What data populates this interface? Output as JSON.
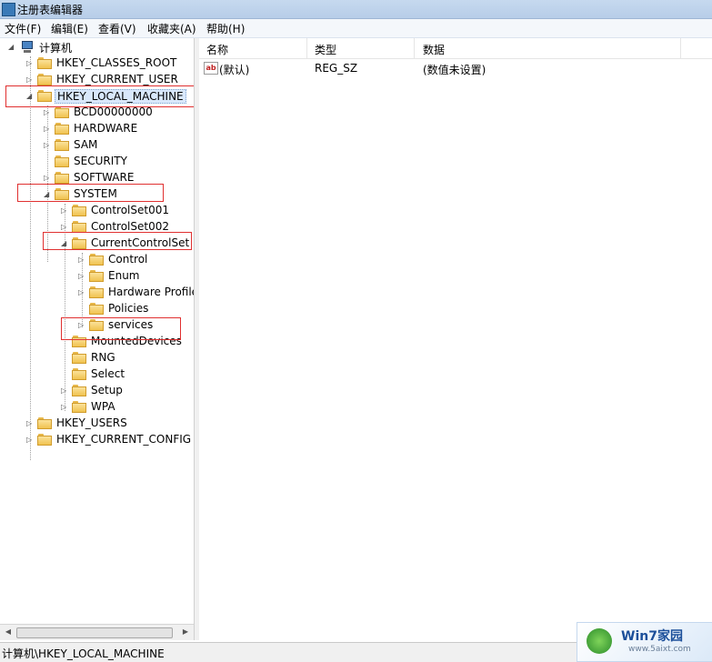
{
  "window": {
    "title": "注册表编辑器"
  },
  "menu": [
    "文件(F)",
    "编辑(E)",
    "查看(V)",
    "收藏夹(A)",
    "帮助(H)"
  ],
  "tree": {
    "root": "计算机",
    "hkcr": "HKEY_CLASSES_ROOT",
    "hkcu": "HKEY_CURRENT_USER",
    "hklm": "HKEY_LOCAL_MACHINE",
    "bcd": "BCD00000000",
    "hardware": "HARDWARE",
    "sam": "SAM",
    "security": "SECURITY",
    "software": "SOFTWARE",
    "system": "SYSTEM",
    "cs001": "ControlSet001",
    "cs002": "ControlSet002",
    "ccs": "CurrentControlSet",
    "control": "Control",
    "enum": "Enum",
    "hwprofiles": "Hardware Profiles",
    "policies": "Policies",
    "services": "services",
    "mounted": "MountedDevices",
    "rng": "RNG",
    "select": "Select",
    "setup": "Setup",
    "wpa": "WPA",
    "hku": "HKEY_USERS",
    "hkcc": "HKEY_CURRENT_CONFIG"
  },
  "list": {
    "columns": [
      "名称",
      "类型",
      "数据"
    ],
    "rows": [
      {
        "name": "(默认)",
        "type": "REG_SZ",
        "data": "(数值未设置)",
        "icon": "ab"
      }
    ]
  },
  "status": "计算机\\HKEY_LOCAL_MACHINE",
  "watermark": {
    "title": "Win7家园",
    "url": "www.5aixt.com"
  },
  "icons": {
    "folder": "folder-icon",
    "computer": "computer-icon",
    "string_value": "ab-string-icon"
  },
  "colors": {
    "highlight_box": "#e03030",
    "selection": "#d9e8fb",
    "folder": "#f0c24f"
  }
}
